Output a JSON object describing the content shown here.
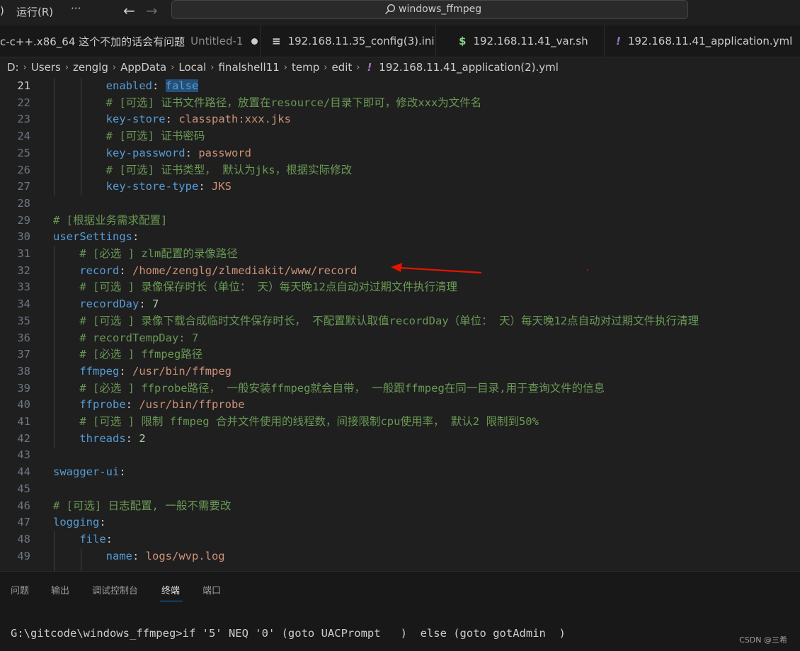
{
  "titlebar": {
    "menu_paren": ")",
    "menu_run": "运行(R)",
    "menu_more": "···",
    "back_icon": "←",
    "forward_icon": "→",
    "search_text": "windows_ffmpeg"
  },
  "tabs": [
    {
      "label": "c-c++.x86_64 这个不加的话会有问题",
      "desc": "Untitled-1",
      "dirty": true
    },
    {
      "icon": "≡",
      "label": "192.168.11.35_config(3).ini"
    },
    {
      "icon": "$",
      "label": "192.168.11.41_var.sh"
    },
    {
      "icon": "!",
      "label": "192.168.11.41_application.yml"
    }
  ],
  "breadcrumb": [
    "D:",
    "Users",
    "zenglg",
    "AppData",
    "Local",
    "finalshell11",
    "temp",
    "edit"
  ],
  "breadcrumb_file_icon": "!",
  "breadcrumb_file": "192.168.11.41_application(2).yml",
  "editor": {
    "current_line": "21",
    "lines": [
      {
        "n": "21",
        "indent": "        ",
        "parts": [
          [
            "k",
            "enabled"
          ],
          [
            "p",
            ": "
          ],
          [
            "hl",
            "false"
          ]
        ]
      },
      {
        "n": "22",
        "indent": "        ",
        "parts": [
          [
            "c",
            "# [可选] 证书文件路径，放置在resource/目录下即可，修改xxx为文件名"
          ]
        ]
      },
      {
        "n": "23",
        "indent": "        ",
        "parts": [
          [
            "k",
            "key-store"
          ],
          [
            "p",
            ": "
          ],
          [
            "s",
            "classpath:xxx.jks"
          ]
        ]
      },
      {
        "n": "24",
        "indent": "        ",
        "parts": [
          [
            "c",
            "# [可选] 证书密码"
          ]
        ]
      },
      {
        "n": "25",
        "indent": "        ",
        "parts": [
          [
            "k",
            "key-password"
          ],
          [
            "p",
            ": "
          ],
          [
            "s",
            "password"
          ]
        ]
      },
      {
        "n": "26",
        "indent": "        ",
        "parts": [
          [
            "c",
            "# [可选] 证书类型， 默认为jks，根据实际修改"
          ]
        ]
      },
      {
        "n": "27",
        "indent": "        ",
        "parts": [
          [
            "k",
            "key-store-type"
          ],
          [
            "p",
            ": "
          ],
          [
            "s",
            "JKS"
          ]
        ]
      },
      {
        "n": "28",
        "indent": "",
        "parts": []
      },
      {
        "n": "29",
        "indent": "",
        "parts": [
          [
            "c",
            "# [根据业务需求配置]"
          ]
        ]
      },
      {
        "n": "30",
        "indent": "",
        "parts": [
          [
            "k",
            "userSettings"
          ],
          [
            "p",
            ":"
          ]
        ]
      },
      {
        "n": "31",
        "indent": "    ",
        "parts": [
          [
            "c",
            "# [必选 ] zlm配置的录像路径"
          ]
        ]
      },
      {
        "n": "32",
        "indent": "    ",
        "parts": [
          [
            "k",
            "record"
          ],
          [
            "p",
            ": "
          ],
          [
            "s",
            "/home/zenglg/zlmediakit/www/record"
          ]
        ]
      },
      {
        "n": "33",
        "indent": "    ",
        "parts": [
          [
            "c",
            "# [可选 ] 录像保存时长（单位： 天）每天晚12点自动对过期文件执行清理"
          ]
        ]
      },
      {
        "n": "34",
        "indent": "    ",
        "parts": [
          [
            "k",
            "recordDay"
          ],
          [
            "p",
            ": "
          ],
          [
            "n",
            "7"
          ]
        ]
      },
      {
        "n": "35",
        "indent": "    ",
        "parts": [
          [
            "c",
            "# [可选 ] 录像下载合成临时文件保存时长， 不配置默认取值recordDay（单位： 天）每天晚12点自动对过期文件执行清理"
          ]
        ]
      },
      {
        "n": "36",
        "indent": "    ",
        "parts": [
          [
            "c",
            "# recordTempDay: 7"
          ]
        ]
      },
      {
        "n": "37",
        "indent": "    ",
        "parts": [
          [
            "c",
            "# [必选 ] ffmpeg路径"
          ]
        ]
      },
      {
        "n": "38",
        "indent": "    ",
        "parts": [
          [
            "k",
            "ffmpeg"
          ],
          [
            "p",
            ": "
          ],
          [
            "s",
            "/usr/bin/ffmpeg"
          ]
        ]
      },
      {
        "n": "39",
        "indent": "    ",
        "parts": [
          [
            "c",
            "# [必选 ] ffprobe路径， 一般安装ffmpeg就会自带， 一般跟ffmpeg在同一目录,用于查询文件的信息"
          ]
        ]
      },
      {
        "n": "40",
        "indent": "    ",
        "parts": [
          [
            "k",
            "ffprobe"
          ],
          [
            "p",
            ": "
          ],
          [
            "s",
            "/usr/bin/ffprobe"
          ]
        ]
      },
      {
        "n": "41",
        "indent": "    ",
        "parts": [
          [
            "c",
            "# [可选 ] 限制 ffmpeg 合并文件使用的线程数，间接限制cpu使用率， 默认2 限制到50%"
          ]
        ]
      },
      {
        "n": "42",
        "indent": "    ",
        "parts": [
          [
            "k",
            "threads"
          ],
          [
            "p",
            ": "
          ],
          [
            "n",
            "2"
          ]
        ]
      },
      {
        "n": "43",
        "indent": "",
        "parts": []
      },
      {
        "n": "44",
        "indent": "",
        "parts": [
          [
            "k",
            "swagger-ui"
          ],
          [
            "p",
            ":"
          ]
        ]
      },
      {
        "n": "45",
        "indent": "",
        "parts": []
      },
      {
        "n": "46",
        "indent": "",
        "parts": [
          [
            "c",
            "# [可选] 日志配置, 一般不需要改"
          ]
        ]
      },
      {
        "n": "47",
        "indent": "",
        "parts": [
          [
            "k",
            "logging"
          ],
          [
            "p",
            ":"
          ]
        ]
      },
      {
        "n": "48",
        "indent": "    ",
        "parts": [
          [
            "k",
            "file"
          ],
          [
            "p",
            ":"
          ]
        ]
      },
      {
        "n": "49",
        "indent": "        ",
        "parts": [
          [
            "k",
            "name"
          ],
          [
            "p",
            ": "
          ],
          [
            "s",
            "logs/wvp.log"
          ]
        ]
      }
    ]
  },
  "panel": {
    "tabs": [
      "问题",
      "输出",
      "调试控制台",
      "终端",
      "端口"
    ],
    "active_tab": "终端",
    "terminal_line": "G:\\gitcode\\windows_ffmpeg>if '5' NEQ '0' (goto UACPrompt   )  else (goto gotAdmin  )"
  },
  "watermark": "CSDN @三希",
  "colors": {
    "arrow": "#e51400",
    "accent": "#0078d4"
  }
}
